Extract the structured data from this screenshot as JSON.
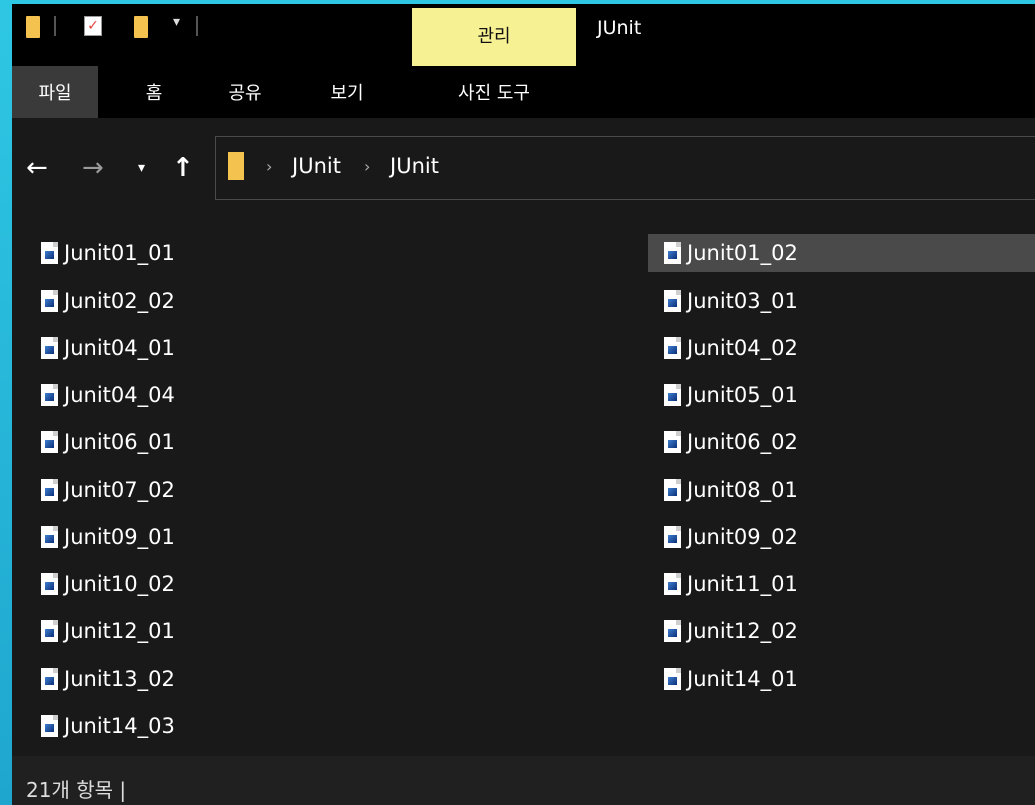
{
  "window": {
    "title": "JUnit",
    "context_tab": "관리",
    "context_group": "사진 도구"
  },
  "ribbon": {
    "tabs": [
      {
        "label": "파일",
        "active": true
      },
      {
        "label": "홈",
        "active": false
      },
      {
        "label": "공유",
        "active": false
      },
      {
        "label": "보기",
        "active": false
      }
    ]
  },
  "address": {
    "crumbs": [
      "JUnit",
      "JUnit"
    ]
  },
  "files": {
    "left": [
      "Junit01_01",
      "Junit02_02",
      "Junit04_01",
      "Junit04_04",
      "Junit06_01",
      "Junit07_02",
      "Junit09_01",
      "Junit10_02",
      "Junit12_01",
      "Junit13_02",
      "Junit14_03"
    ],
    "right": [
      "Junit01_02",
      "Junit03_01",
      "Junit04_02",
      "Junit05_01",
      "Junit06_02",
      "Junit08_01",
      "Junit09_02",
      "Junit11_01",
      "Junit12_02",
      "Junit14_01"
    ],
    "selected": "Junit01_02"
  },
  "status": {
    "text": "21개 항목 |"
  },
  "colors": {
    "accent_manage": "#f6f293",
    "folder": "#f4c34f",
    "selection": "#4a4a4a"
  },
  "icons": {
    "back": "back-arrow-icon",
    "forward": "forward-arrow-icon",
    "recent": "chevron-down-icon",
    "up": "up-arrow-icon",
    "folder": "folder-icon",
    "file": "image-file-icon"
  }
}
